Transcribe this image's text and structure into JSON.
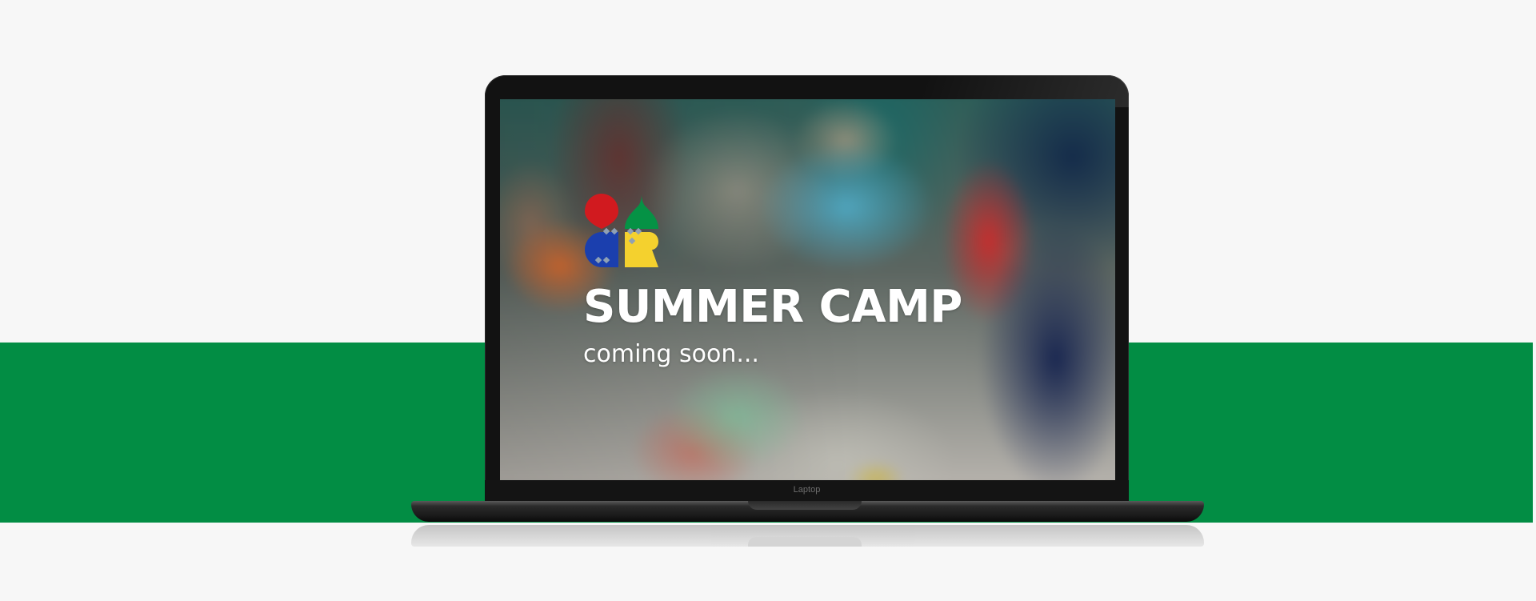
{
  "page": {
    "background_color": "#f7f7f7",
    "band_color": "#028d44"
  },
  "laptop": {
    "brand_label": "Laptop",
    "frame_color": "#121212"
  },
  "screen": {
    "logo_icon": "camp-logo-icon",
    "logo_colors": {
      "red": "#d11a1f",
      "green": "#059245",
      "blue": "#1b3fae",
      "yellow": "#f4d12e"
    },
    "title": "SUMMER CAMP",
    "subtitle": "coming soon..."
  }
}
